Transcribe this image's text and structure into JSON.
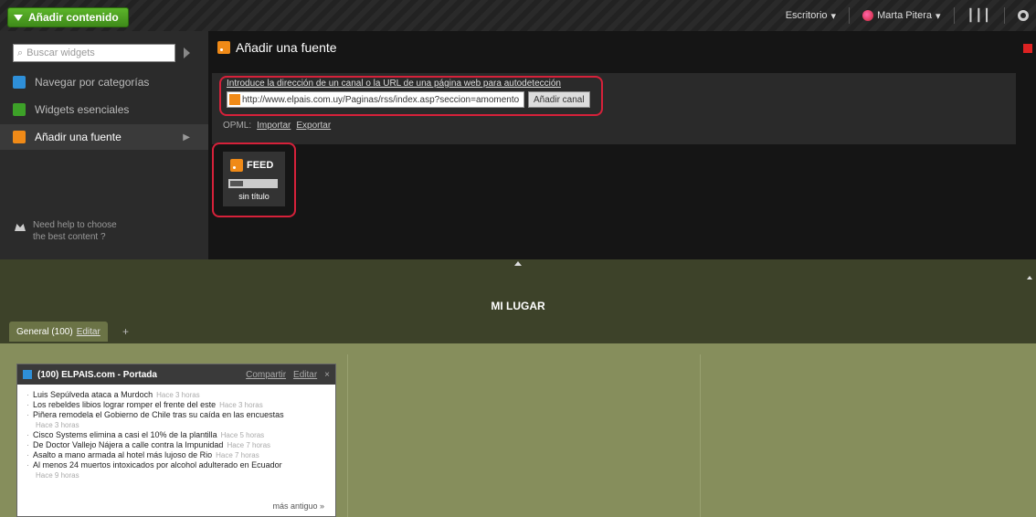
{
  "topbar": {
    "add_content_label": "Añadir contenido",
    "user_menu_label": "Marta Pitera",
    "lang_menu_label": "Escritorio"
  },
  "sidebar": {
    "search_placeholder": "Buscar widgets",
    "items": [
      {
        "label": "Navegar por categorías"
      },
      {
        "label": "Widgets esenciales"
      },
      {
        "label": "Añadir una fuente"
      }
    ],
    "help_line1": "Need help to choose",
    "help_line2": "the best content ?"
  },
  "panel": {
    "title": "Añadir una fuente",
    "url_caption": "Introduce la dirección de un canal o la URL de una página web para autodetección",
    "url_value": "http://www.elpais.com.uy/Paginas/rss/index.asp?seccion=amomento",
    "add_button": "Añadir canal",
    "opml_label": "OPML:",
    "import_link": "Importar",
    "export_link": "Exportar"
  },
  "feed": {
    "label": "FEED",
    "title": "sin título"
  },
  "page": {
    "title": "MI LUGAR",
    "tab_label": "General (100)",
    "tab_edit": "Editar"
  },
  "widget": {
    "title": "(100) ELPAIS.com - Portada",
    "share": "Compartir",
    "edit": "Editar",
    "more": "más antiguo »",
    "items": [
      {
        "text": "Luis Sepúlveda ataca a Murdoch",
        "meta": "Hace 3 horas"
      },
      {
        "text": "Los rebeldes libios lograr romper el frente del este",
        "meta": "Hace 3 horas"
      },
      {
        "text": "Piñera remodela el Gobierno de Chile tras su caída en las encuestas",
        "meta": "Hace 3 horas"
      },
      {
        "text": "Cisco Systems elimina a casi el 10% de la plantilla",
        "meta": "Hace 5 horas"
      },
      {
        "text": "De Doctor Vallejo Nájera a calle contra la Impunidad",
        "meta": "Hace 7 horas"
      },
      {
        "text": "Asalto a mano armada al hotel más lujoso de Rio",
        "meta": "Hace 7 horas"
      },
      {
        "text": "Al menos 24 muertos intoxicados por alcohol adulterado en Ecuador",
        "meta": "Hace 9 horas"
      }
    ]
  }
}
